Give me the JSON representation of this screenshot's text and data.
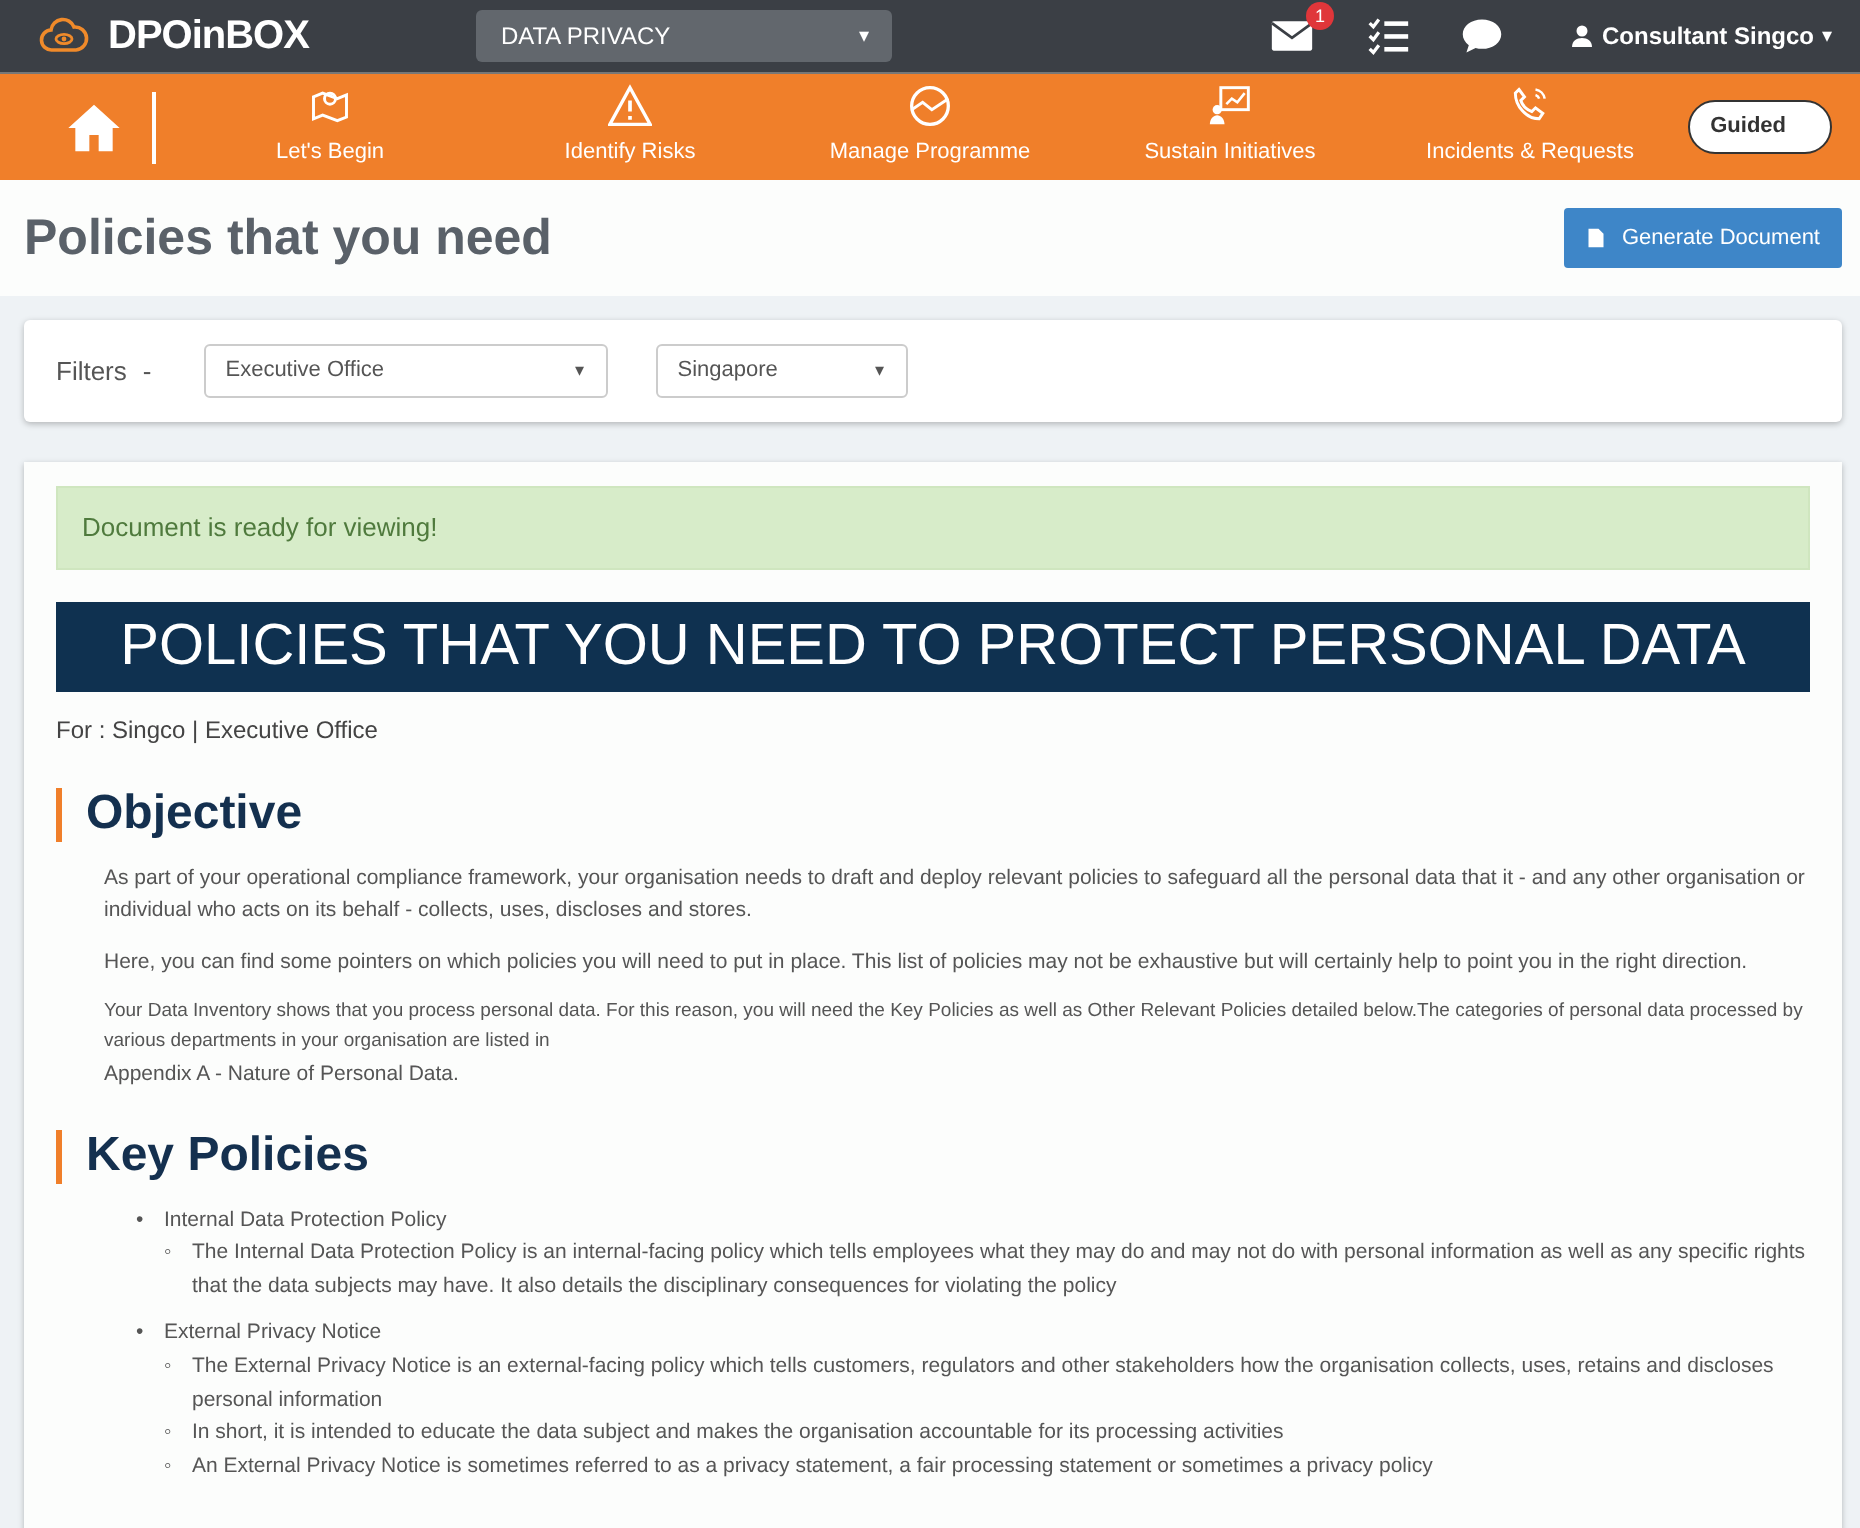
{
  "header": {
    "logo_text": "DPOinBOX",
    "module_select": "DATA PRIVACY",
    "module_caret": "▾",
    "mail_badge": "1",
    "user": "Consultant Singco",
    "user_caret": "▾"
  },
  "nav": {
    "items": [
      {
        "label": "Let's Begin",
        "kind": "map"
      },
      {
        "label": "Identify Risks",
        "kind": "warning"
      },
      {
        "label": "Manage Programme",
        "kind": "chart"
      },
      {
        "label": "Sustain Initiatives",
        "kind": "board"
      },
      {
        "label": "Incidents & Requests",
        "kind": "phone"
      }
    ],
    "guided": "Guided"
  },
  "page": {
    "title": "Policies that you need",
    "generate_button": "Generate Document"
  },
  "filters": {
    "label": "Filters",
    "separator": "-",
    "selects": [
      {
        "value": "Executive Office",
        "caret": "▾"
      },
      {
        "value": "Singapore",
        "caret": "▾"
      }
    ]
  },
  "document": {
    "alert": "Document is ready for viewing!",
    "banner": "POLICIES THAT YOU NEED TO PROTECT PERSONAL DATA",
    "for_line": "For : Singco | Executive Office",
    "sections": [
      {
        "heading": "Objective",
        "paragraphs": [
          {
            "kind": "normal",
            "text": "As part of your operational compliance framework, your organisation needs to draft and deploy relevant policies to safeguard all the personal data that it - and any other organisation or individual who acts on its behalf - collects, uses, discloses and stores."
          },
          {
            "kind": "normal",
            "text": "Here, you can find some pointers on which policies you will need to put in place. This list of policies may not be exhaustive but will certainly help to point you in the right direction."
          },
          {
            "kind": "small",
            "text": "Your Data Inventory shows that you process personal data. For this reason, you will need the Key Policies as well as Other Relevant Policies detailed below.The categories of personal data processed by various departments in your organisation are listed in"
          },
          {
            "kind": "normal",
            "text": "Appendix A - Nature of Personal Data."
          }
        ]
      },
      {
        "heading": "Key Policies",
        "items": [
          {
            "marker": "•",
            "label": "Internal Data Protection Policy",
            "children": [
              {
                "marker": "◦",
                "label": "The Internal Data Protection Policy is an internal-facing policy which tells employees what they may do and may not do with personal information as well as any specific rights that the data subjects may have. It also details the disciplinary consequences for violating the policy"
              }
            ]
          },
          {
            "marker": "•",
            "label": "External Privacy Notice",
            "children": [
              {
                "marker": "◦",
                "label": "The External Privacy Notice is an external-facing policy which tells customers, regulators and other stakeholders how the organisation collects, uses, retains and discloses personal information"
              },
              {
                "marker": "◦",
                "label": "In short, it is intended to educate the data subject and makes the organisation accountable for its processing activities"
              },
              {
                "marker": "◦",
                "label": "An External Privacy Notice is sometimes referred to as a privacy statement, a fair processing statement or sometimes a privacy policy"
              }
            ]
          }
        ]
      }
    ]
  }
}
